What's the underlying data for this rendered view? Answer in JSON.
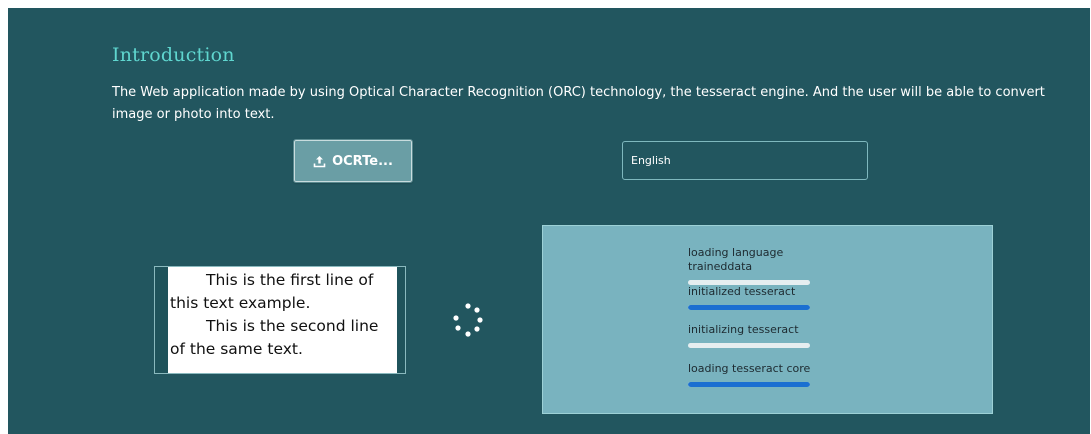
{
  "intro": {
    "title": "Introduction",
    "text": "The Web application made by using Optical Character Recognition (ORC) technology, the tesseract engine. And the user will be able to convert image or photo into text."
  },
  "upload_button": {
    "label": "OCRTe...",
    "icon": "upload-icon"
  },
  "language_select": {
    "value": "English"
  },
  "preview_image": {
    "lines": [
      "This is the first line of",
      "this text example.",
      "This is the second line",
      "of the same text."
    ]
  },
  "progress": {
    "steps": [
      {
        "label": "loading language traineddata",
        "progress": 0.0,
        "color": "#e6eef0"
      },
      {
        "label": "initialized tesseract",
        "progress": 1.0,
        "color": "#1b6fd1"
      },
      {
        "label": "initializing tesseract",
        "progress": 0.0,
        "color": "#e6eef0"
      },
      {
        "label": "loading tesseract core",
        "progress": 1.0,
        "color": "#1b6fd1"
      }
    ]
  },
  "colors": {
    "background": "#22565f",
    "title": "#5fd6cf",
    "panel": "#79b3bf",
    "bar_active": "#1b6fd1"
  }
}
